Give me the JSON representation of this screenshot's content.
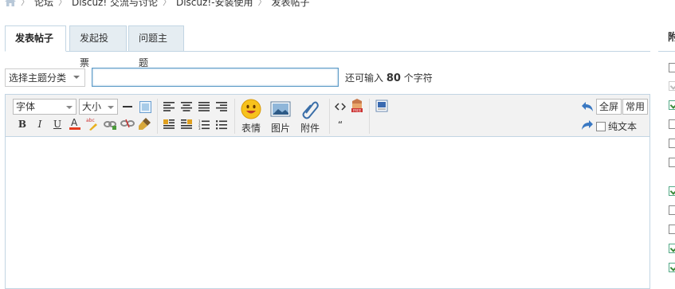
{
  "breadcrumb": {
    "items": [
      "论坛",
      "Discuz! 交流与讨论",
      "Discuz!-安装使用",
      "发表帖子"
    ]
  },
  "tabs": [
    {
      "label": "发表帖子",
      "active": true
    },
    {
      "label": "发起投票",
      "active": false
    },
    {
      "label": "问题主题",
      "active": false
    }
  ],
  "subject": {
    "category_select": "选择主题分类",
    "title_value": "",
    "hint_prefix": "还可输入",
    "hint_count": "80",
    "hint_suffix": "个字符"
  },
  "toolbar": {
    "font_label": "字体",
    "size_label": "大小",
    "emoticon_label": "表情",
    "image_label": "图片",
    "attach_label": "附件",
    "fullscreen_label": "全屏",
    "common_label": "常用",
    "plaintext_label": "纯文本",
    "bold": "B",
    "italic": "I",
    "underline": "U",
    "fontcolor": "A",
    "quote": "“"
  },
  "side": {
    "title": "附",
    "checkboxes": [
      "unchecked",
      "dim-checked",
      "checked",
      "unchecked",
      "unchecked",
      "unchecked",
      "checked",
      "unchecked",
      "unchecked",
      "checked",
      "checked"
    ]
  },
  "colors": {
    "tab_bg": "#e5edf2",
    "border": "#c2d5e3",
    "input_focus": "#5c9ac7",
    "toolbar_bg": "#f2f2f2"
  }
}
